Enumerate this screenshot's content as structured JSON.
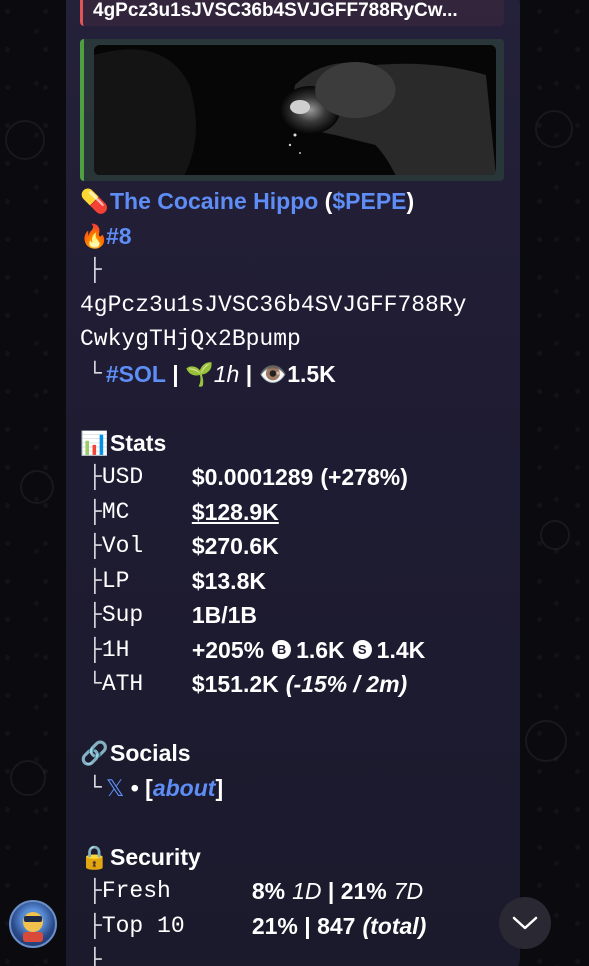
{
  "reply": {
    "text": "4gPcz3u1sJVSC36b4SVJGFF788RyCw..."
  },
  "token": {
    "pill_icon": "pill-icon",
    "name": "The Cocaine Hippo",
    "ticker": "$PEPE",
    "rank": "#8",
    "address_line1": "4gPcz3u1sJVSC36b4SVJGFF788Ry",
    "address_line2": "CwkygTHjQx2Bpump",
    "chain": "#SOL",
    "age": "1h",
    "views": "1.5K"
  },
  "stats": {
    "header": "Stats",
    "usd_label": "USD",
    "usd_value": "$0.0001289",
    "usd_change": "(+278%)",
    "mc_label": "MC",
    "mc_value": "$128.9K",
    "vol_label": "Vol",
    "vol_value": "$270.6K",
    "lp_label": "LP",
    "lp_value": "$13.8K",
    "sup_label": "Sup",
    "sup_value": "1B/1B",
    "h1_label": "1H",
    "h1_change": "+205%",
    "h1_buy": "1.6K",
    "h1_sell": "1.4K",
    "ath_label": "ATH",
    "ath_value": "$151.2K",
    "ath_detail": "(-15% / 2m)"
  },
  "socials": {
    "header": "Socials",
    "x_label": "𝕏",
    "about": "about"
  },
  "security": {
    "header": "Security",
    "fresh_label": "Fresh",
    "fresh_1d": "8%",
    "fresh_1d_unit": "1D",
    "fresh_7d": "21%",
    "fresh_7d_unit": "7D",
    "top10_label": "Top 10",
    "top10_value": "21%",
    "top10_total": "847",
    "top10_total_label": "(total)"
  },
  "colors": {
    "link": "#5e8ef5",
    "accent_green": "#4fa043",
    "reply_red": "#e05555",
    "bubble": "#1f1c33"
  }
}
